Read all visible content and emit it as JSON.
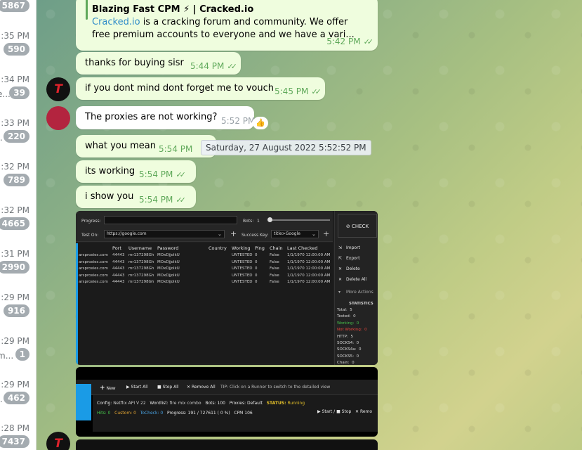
{
  "sidebar": {
    "rows": [
      {
        "time": "",
        "snippet": "",
        "badge": "5867"
      },
      {
        "time": ":35 PM",
        "snippet": "",
        "badge": "590"
      },
      {
        "time": ":34 PM",
        "snippet": "e...",
        "badge": "39"
      },
      {
        "time": ":33 PM",
        "snippet": "..",
        "badge": "220"
      },
      {
        "time": ":32 PM",
        "snippet": "",
        "badge": "789"
      },
      {
        "time": ":32 PM",
        "snippet": "",
        "badge": "4665"
      },
      {
        "time": ":31 PM",
        "snippet": "",
        "badge": "2990"
      },
      {
        "time": ":29 PM",
        "snippet": "",
        "badge": "916"
      },
      {
        "time": ":29 PM",
        "snippet": "m...",
        "badge": "1"
      },
      {
        "time": ":29 PM",
        "snippet": "..",
        "badge": "462"
      },
      {
        "time": ":28 PM",
        "snippet": "",
        "badge": "7437"
      }
    ]
  },
  "preview": {
    "title": "Blazing Fast CPM ⚡ | Cracked.io",
    "link": "Cracked.io",
    "text": " is a cracking forum and community. We offer free premium accounts to everyone and we have a vari...",
    "time": "5:42 PM"
  },
  "messages": [
    {
      "text": "thanks for buying sisr",
      "time": "5:44 PM"
    },
    {
      "text": "if you dont mind dont forget me to vouch",
      "time": "5:45 PM"
    },
    {
      "text": "The proxies are not working?",
      "time": "5:52 PM"
    },
    {
      "text": "what you mean",
      "time": "5:54 PM"
    },
    {
      "text": "its working",
      "time": "5:54 PM"
    },
    {
      "text": "i show you",
      "time": "5:54 PM"
    }
  ],
  "reaction": "👍",
  "tooltip": "Saturday, 27 August 2022 5:52:52 PM",
  "avatar_letter": "T",
  "shot1": {
    "progress_label": "Progress:",
    "bots_label": "Bots:",
    "bots_value": "1",
    "test_on_label": "Test On:",
    "test_on_value": "https://google.com",
    "success_key_label": "Success Key:",
    "success_key_value": "title>Google",
    "check_label": "CHECK",
    "headers": [
      "Port",
      "Username",
      "Password",
      "Country",
      "Working",
      "Ping",
      "Chain",
      "Last Checked"
    ],
    "rows": [
      {
        "host": "arsproxies.com",
        "port": "44443",
        "user": "mr137298Gh",
        "pass": "MOxDjjolkU",
        "working": "UNTESTED",
        "ping": "0",
        "chain": "False",
        "checked": "1/1/1970 12:00:00 AM"
      },
      {
        "host": "arsproxies.com",
        "port": "44443",
        "user": "mr137298Gh",
        "pass": "MOxDjjolkU",
        "working": "UNTESTED",
        "ping": "0",
        "chain": "False",
        "checked": "1/1/1970 12:00:00 AM"
      },
      {
        "host": "arsproxies.com",
        "port": "44443",
        "user": "mr137298Gh",
        "pass": "MOxDjjolkU",
        "working": "UNTESTED",
        "ping": "0",
        "chain": "False",
        "checked": "1/1/1970 12:00:00 AM"
      },
      {
        "host": "arsproxies.com",
        "port": "44443",
        "user": "mr137298Gh",
        "pass": "MOxDjjolkU",
        "working": "UNTESTED",
        "ping": "0",
        "chain": "False",
        "checked": "1/1/1970 12:00:00 AM"
      },
      {
        "host": "arsproxies.com",
        "port": "44443",
        "user": "mr137298Gh",
        "pass": "MOxDjjolkU",
        "working": "UNTESTED",
        "ping": "0",
        "chain": "False",
        "checked": "1/1/1970 12:00:00 AM"
      }
    ],
    "buttons": [
      "Import",
      "Export",
      "Delete",
      "Delete All",
      "More Actions"
    ],
    "stats_title": "STATISTICS",
    "stats": [
      {
        "label": "Total:",
        "value": "5",
        "color": "#d6d6d6"
      },
      {
        "label": "Tested:",
        "value": "0",
        "color": "#d6d6d6"
      },
      {
        "label": "Working:",
        "value": "0",
        "color": "#46c24a"
      },
      {
        "label": "Not Working:",
        "value": "0",
        "color": "#e8453c"
      },
      {
        "label": "HTTP:",
        "value": "5",
        "color": "#d6d6d6"
      },
      {
        "label": "SOCKS4:",
        "value": "0",
        "color": "#d6d6d6"
      },
      {
        "label": "SOCKS4a:",
        "value": "0",
        "color": "#d6d6d6"
      },
      {
        "label": "SOCKS5:",
        "value": "0",
        "color": "#d6d6d6"
      },
      {
        "label": "Chain:",
        "value": "0",
        "color": "#d6d6d6"
      }
    ]
  },
  "shot2": {
    "toolbar": [
      "New",
      "Start All",
      "Stop All",
      "Remove All"
    ],
    "tip": "TIP: Click on a Runner to switch to the detailed view",
    "config_label": "Config:",
    "config_value": "Netflix API V 22",
    "wordlist_label": "Wordlist:",
    "wordlist_value": "fire mix combo",
    "bots_label": "Bots:",
    "bots_value": "100",
    "proxies_label": "Proxies:",
    "proxies_value": "Default",
    "status_label": "STATUS:",
    "status_value": "Running",
    "hits_label": "Hits:",
    "hits_value": "0",
    "custom_label": "Custom:",
    "custom_value": "0",
    "tocheck_label": "ToCheck:",
    "tocheck_value": "0",
    "progress_label": "Progress:",
    "progress_value": "191 / 727611 ( 0 %)",
    "cpm_label": "CPM",
    "cpm_value": "106",
    "start_label": "Start",
    "stop_label": "Stop",
    "remove_label": "Remo"
  }
}
